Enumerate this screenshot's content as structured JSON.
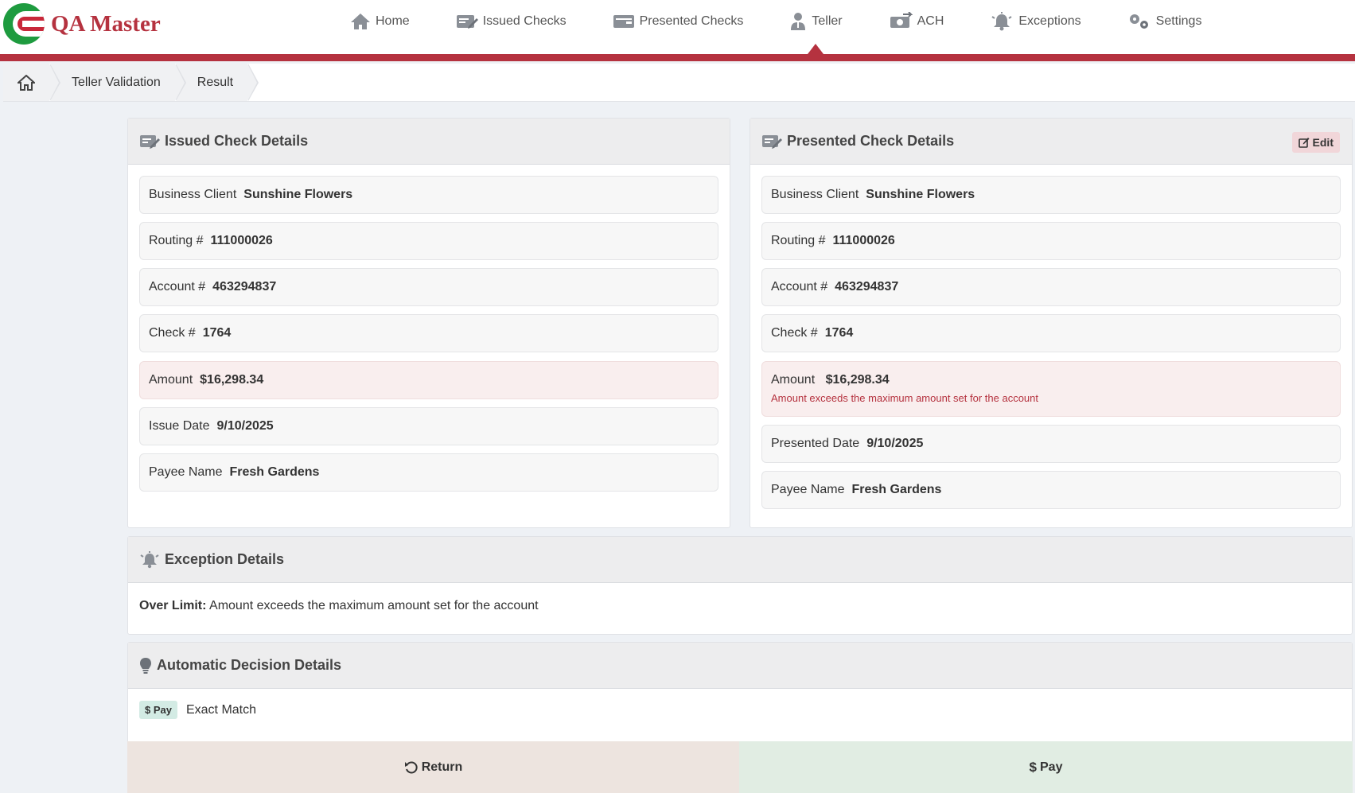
{
  "app": {
    "title": "QA Master"
  },
  "nav": {
    "items": [
      {
        "label": "Home",
        "icon": "home-icon"
      },
      {
        "label": "Issued Checks",
        "icon": "issued-checks-icon"
      },
      {
        "label": "Presented Checks",
        "icon": "presented-checks-icon"
      },
      {
        "label": "Teller",
        "icon": "teller-icon",
        "active": true
      },
      {
        "label": "ACH",
        "icon": "ach-icon"
      },
      {
        "label": "Exceptions",
        "icon": "bell-icon"
      },
      {
        "label": "Settings",
        "icon": "gears-icon"
      }
    ]
  },
  "breadcrumb": {
    "items": [
      "Teller Validation",
      "Result"
    ]
  },
  "issued": {
    "title": "Issued Check Details",
    "business_client_label": "Business Client",
    "business_client": "Sunshine Flowers",
    "routing_label": "Routing #",
    "routing": "111000026",
    "account_label": "Account #",
    "account": "463294837",
    "check_label": "Check #",
    "check": "1764",
    "amount_label": "Amount",
    "amount": "$16,298.34",
    "issue_date_label": "Issue Date",
    "issue_date": "9/10/2025",
    "payee_label": "Payee Name",
    "payee": "Fresh Gardens"
  },
  "presented": {
    "title": "Presented Check Details",
    "edit_label": "Edit",
    "business_client_label": "Business Client",
    "business_client": "Sunshine Flowers",
    "routing_label": "Routing #",
    "routing": "111000026",
    "account_label": "Account #",
    "account": "463294837",
    "check_label": "Check #",
    "check": "1764",
    "amount_label": "Amount",
    "amount": "$16,298.34",
    "amount_warning": "Amount exceeds the maximum amount set for the account",
    "presented_date_label": "Presented Date",
    "presented_date": "9/10/2025",
    "payee_label": "Payee Name",
    "payee": "Fresh Gardens"
  },
  "exception": {
    "title": "Exception Details",
    "type": "Over Limit:",
    "message": "Amount exceeds the maximum amount set for the account"
  },
  "decision": {
    "title": "Automatic Decision Details",
    "badge": "Pay",
    "result": "Exact Match"
  },
  "actions": {
    "return_label": "Return",
    "pay_label": "Pay"
  },
  "colors": {
    "brand_red": "#b5323f",
    "logo_green": "#1e9b3f",
    "return_bg": "#ede4df",
    "pay_bg": "#e1ede3"
  }
}
